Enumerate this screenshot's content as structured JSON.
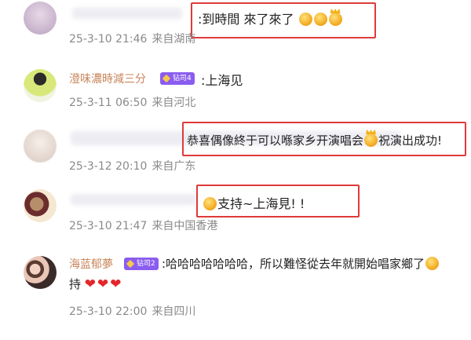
{
  "comments": [
    {
      "username": "",
      "text": ":到時間 來了來了",
      "date": "25-3-10 21:46",
      "location": "来自湖南",
      "emojis": [
        "emoji-1",
        "emoji-2",
        "emoji-3"
      ]
    },
    {
      "username": "澄味濃時減三分",
      "badge": "钻司4",
      "text": ":上海见",
      "date": "25-3-11 06:50",
      "location": "来自河北"
    },
    {
      "username": "",
      "text_before": "恭喜偶像終于可以喺家乡开演唱会",
      "text_after": "祝演出成功!",
      "date": "25-3-12 20:10",
      "location": "来自广东"
    },
    {
      "username": "",
      "text": "支持~上海見! !",
      "date": "25-3-10 21:47",
      "location": "来自中国香港"
    },
    {
      "username": "海蓝郁夢",
      "badge": "钻司2",
      "text_line1": ":哈哈哈哈哈哈哈，所以難怪從去年就開始唱家鄉了",
      "text_line2": "持",
      "hearts": [
        "❤",
        "❤",
        "❤"
      ],
      "date": "25-3-10 22:00",
      "location": "来自四川"
    }
  ],
  "colors": {
    "highlight": "#e03a3a",
    "username": "#c8845a",
    "meta": "#8a8a8a",
    "badge": "#8a5cf0"
  }
}
